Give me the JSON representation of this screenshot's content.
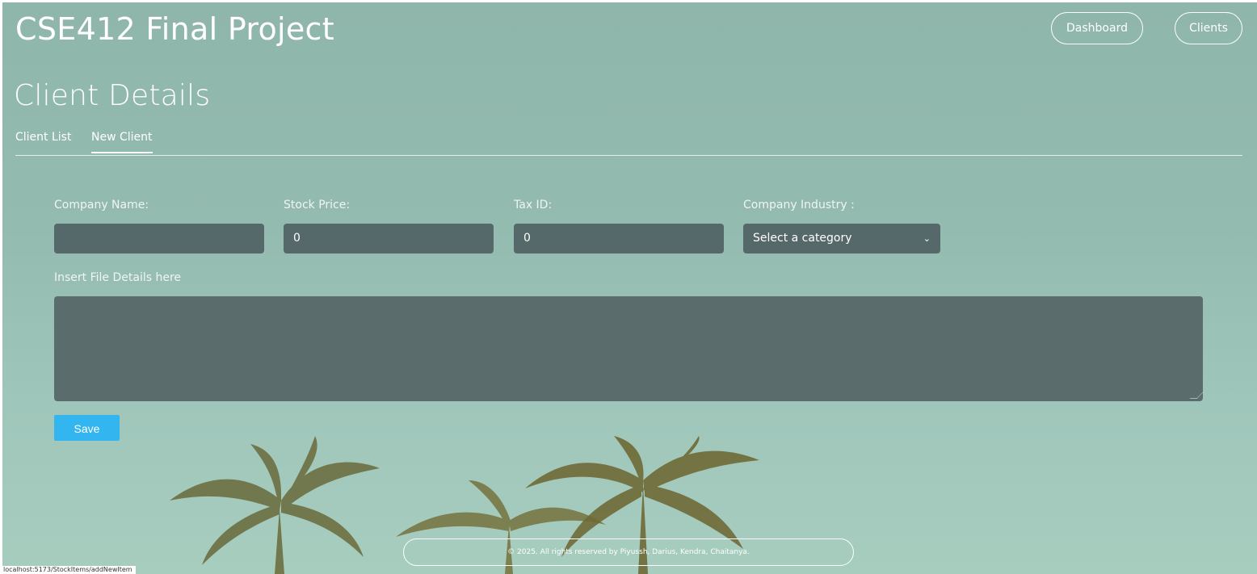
{
  "header": {
    "app_title": "CSE412 Final Project",
    "nav": {
      "dashboard_label": "Dashboard",
      "clients_label": "Clients"
    }
  },
  "page": {
    "title": "Client Details",
    "tabs": [
      {
        "label": "Client List",
        "active": false
      },
      {
        "label": "New Client",
        "active": true
      }
    ]
  },
  "form": {
    "company_name": {
      "label": "Company Name:",
      "value": ""
    },
    "stock_price": {
      "label": "Stock Price:",
      "value": "0"
    },
    "tax_id": {
      "label": "Tax ID:",
      "value": "0"
    },
    "company_industry": {
      "label": "Company Industry :",
      "selected": "Select a category"
    },
    "file_details": {
      "label": "Insert File Details here",
      "value": ""
    },
    "save_label": "Save"
  },
  "footer": {
    "text": "© 2025. All rights reserved by Piyussh, Darius, Kendra, Chaitanya."
  },
  "status_bar": {
    "url": "localhost:5173/StockItems/addNewItem"
  },
  "colors": {
    "accent": "#33b6f0",
    "input_bg": "#56696a",
    "background": "#94bbb0"
  }
}
